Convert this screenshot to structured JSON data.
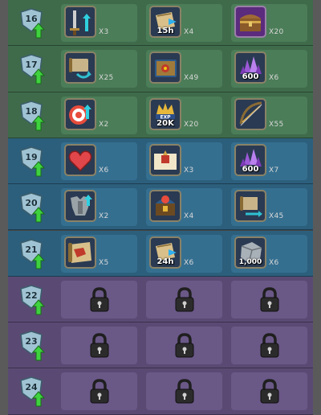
{
  "rows": [
    {
      "level": "16",
      "theme": "green",
      "items": [
        {
          "icon": "sword-upgrade-icon",
          "label": "",
          "qty": "X3"
        },
        {
          "icon": "speed-up-scroll-icon",
          "label": "15h",
          "qty": "X4"
        },
        {
          "icon": "treasure-chest-icon",
          "label": "",
          "qty": "X20"
        }
      ]
    },
    {
      "level": "17",
      "theme": "green",
      "items": [
        {
          "icon": "relocator-scroll-icon",
          "label": "",
          "qty": "X25"
        },
        {
          "icon": "spell-tome-icon",
          "label": "",
          "qty": "X49"
        },
        {
          "icon": "crystal-gems-icon",
          "label": "600",
          "qty": "X6"
        }
      ]
    },
    {
      "level": "18",
      "theme": "green",
      "items": [
        {
          "icon": "target-upgrade-icon",
          "label": "",
          "qty": "X2"
        },
        {
          "icon": "exp-crown-icon",
          "label": "20K",
          "qty": "X20"
        },
        {
          "icon": "crossbow-icon",
          "label": "",
          "qty": "X55"
        }
      ]
    },
    {
      "level": "19",
      "theme": "blue",
      "items": [
        {
          "icon": "heart-icon",
          "label": "",
          "qty": "X6"
        },
        {
          "icon": "holy-book-icon",
          "label": "",
          "qty": "X3"
        },
        {
          "icon": "crystal-gems-icon",
          "label": "600",
          "qty": "X7"
        }
      ]
    },
    {
      "level": "20",
      "theme": "blue",
      "items": [
        {
          "icon": "armor-upgrade-icon",
          "label": "",
          "qty": "X2"
        },
        {
          "icon": "mystery-chest-icon",
          "label": "",
          "qty": "X4"
        },
        {
          "icon": "scroll-swap-icon",
          "label": "",
          "qty": "X45"
        }
      ]
    },
    {
      "level": "21",
      "theme": "blue",
      "items": [
        {
          "icon": "map-scroll-icon",
          "label": "",
          "qty": "X5"
        },
        {
          "icon": "speed-up-scroll-icon",
          "label": "24h",
          "qty": "X6"
        },
        {
          "icon": "stone-block-icon",
          "label": "1,000",
          "qty": "X6"
        }
      ]
    },
    {
      "level": "22",
      "theme": "purple",
      "locked": true
    },
    {
      "level": "23",
      "theme": "purple",
      "locked": true
    },
    {
      "level": "24",
      "theme": "purple",
      "locked": true
    }
  ]
}
